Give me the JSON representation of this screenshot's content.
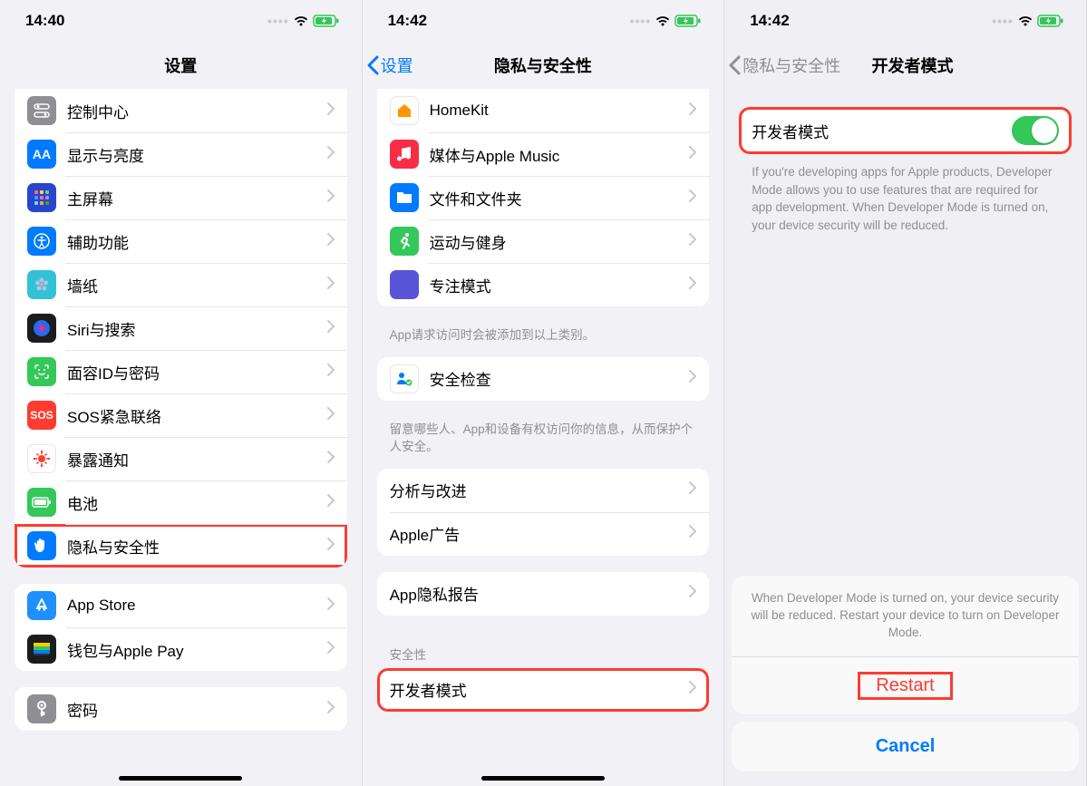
{
  "pane1": {
    "time": "14:40",
    "title": "设置",
    "groups": [
      {
        "cutTop": true,
        "rows": [
          {
            "icon": "toggles",
            "bg": "#8e8e93",
            "label": "控制中心"
          },
          {
            "icon": "AA",
            "bg": "#007aff",
            "label": "显示与亮度"
          },
          {
            "icon": "grid",
            "bg": "#2845d0",
            "label": "主屏幕"
          },
          {
            "icon": "access",
            "bg": "#007aff",
            "label": "辅助功能"
          },
          {
            "icon": "flower",
            "bg": "#33c1d6",
            "label": "墙纸"
          },
          {
            "icon": "siri",
            "bg": "#1c1c1e",
            "label": "Siri与搜索"
          },
          {
            "icon": "faceid",
            "bg": "#34c759",
            "label": "面容ID与密码"
          },
          {
            "icon": "sos",
            "bg": "#ff3b30",
            "label": "SOS紧急联络"
          },
          {
            "icon": "virus",
            "bg": "#ffffff",
            "color": "#ff3b30",
            "label": "暴露通知"
          },
          {
            "icon": "battery",
            "bg": "#34c759",
            "label": "电池"
          },
          {
            "icon": "hand",
            "bg": "#007aff",
            "label": "隐私与安全性",
            "highlight": true
          }
        ]
      },
      {
        "rows": [
          {
            "icon": "appstore",
            "bg": "#1e90ff",
            "label": "App Store"
          },
          {
            "icon": "wallet",
            "bg": "#1c1c1e",
            "label": "钱包与Apple Pay"
          }
        ]
      },
      {
        "cutBottom": true,
        "rows": [
          {
            "icon": "key",
            "bg": "#8e8e93",
            "label": "密码"
          }
        ]
      }
    ]
  },
  "pane2": {
    "time": "14:42",
    "back": "设置",
    "title": "隐私与安全性",
    "groups": [
      {
        "cutTop": true,
        "rows": [
          {
            "icon": "home",
            "bg": "#ffffff",
            "color": "#ff9500",
            "label": "HomeKit"
          },
          {
            "icon": "music",
            "bg": "#fa2d48",
            "label": "媒体与Apple Music"
          },
          {
            "icon": "folder",
            "bg": "#007aff",
            "label": "文件和文件夹"
          },
          {
            "icon": "run",
            "bg": "#34c759",
            "label": "运动与健身"
          },
          {
            "icon": "moon",
            "bg": "#5856d6",
            "label": "专注模式"
          }
        ],
        "footer": "App请求访问时会被添加到以上类别。"
      },
      {
        "rows": [
          {
            "icon": "safety",
            "bg": "#ffffff",
            "color": "#007aff",
            "label": "安全检查"
          }
        ],
        "footer": "留意哪些人、App和设备有权访问你的信息，从而保护个人安全。"
      },
      {
        "rows": [
          {
            "noIcon": true,
            "label": "分析与改进"
          },
          {
            "noIcon": true,
            "label": "Apple广告"
          }
        ]
      },
      {
        "rows": [
          {
            "noIcon": true,
            "label": "App隐私报告"
          }
        ]
      },
      {
        "header": "安全性",
        "highlight": true,
        "rows": [
          {
            "noIcon": true,
            "label": "开发者模式"
          }
        ]
      }
    ]
  },
  "pane3": {
    "time": "14:42",
    "back": "隐私与安全性",
    "title": "开发者模式",
    "toggle_label": "开发者模式",
    "description": "If you're developing apps for Apple products, Developer Mode allows you to use features that are required for app development. When Developer Mode is turned on, your device security will be reduced.",
    "sheet": {
      "message": "When Developer Mode is turned on, your device security will be reduced. Restart your device to turn on Developer Mode.",
      "restart": "Restart",
      "cancel": "Cancel"
    }
  }
}
